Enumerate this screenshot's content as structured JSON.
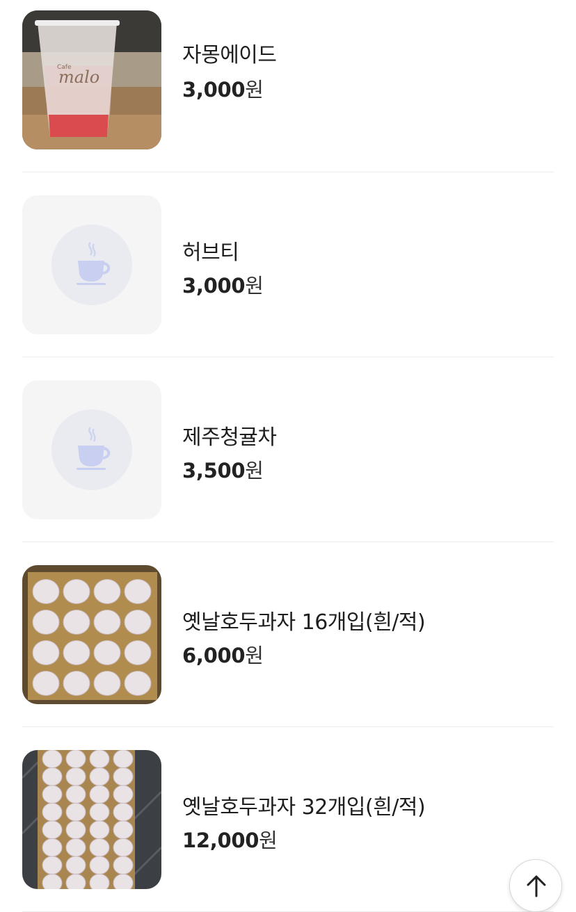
{
  "items": [
    {
      "name": "자몽에이드",
      "price": "3,000",
      "unit": "원",
      "image": "grapefruit-ade-photo"
    },
    {
      "name": "허브티",
      "price": "3,000",
      "unit": "원",
      "image": "coffee-cup-icon"
    },
    {
      "name": "제주청귤차",
      "price": "3,500",
      "unit": "원",
      "image": "coffee-cup-icon"
    },
    {
      "name": "옛날호두과자 16개입(흰/적)",
      "price": "6,000",
      "unit": "원",
      "image": "walnut-cake-16-photo"
    },
    {
      "name": "옛날호두과자 32개입(흰/적)",
      "price": "12,000",
      "unit": "원",
      "image": "walnut-cake-32-photo"
    }
  ],
  "scroll_top_button": {
    "icon": "arrow-up-icon"
  },
  "colors": {
    "placeholder_bg": "#f5f5f6",
    "icon_tint": "#c9cff0",
    "divider": "#ececec"
  }
}
